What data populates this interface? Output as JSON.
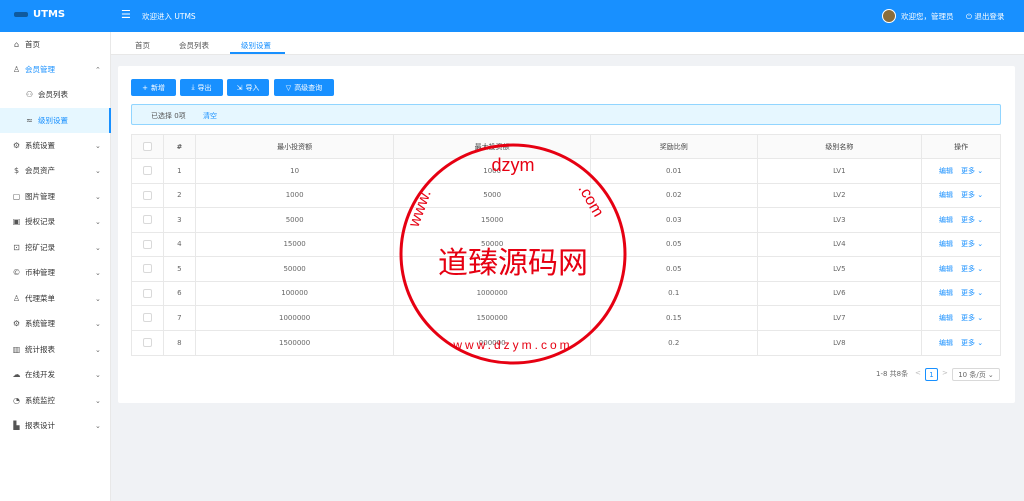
{
  "header": {
    "app_title": "UTMS",
    "fold_icon": "menu-fold-icon",
    "welcome": "欢迎进入 UTMS",
    "greeting": "欢迎您，管理员",
    "logout": "退出登录"
  },
  "sidebar": {
    "items": [
      {
        "icon": "⌂",
        "label": "首页",
        "chevron": ""
      },
      {
        "icon": "♙",
        "label": "会员管理",
        "chevron": "⌃"
      },
      {
        "icon": "⚇",
        "label": "会员列表",
        "chevron": ""
      },
      {
        "icon": "≈",
        "label": "级别设置",
        "chevron": ""
      },
      {
        "icon": "⚙",
        "label": "系统设置",
        "chevron": "⌄"
      },
      {
        "icon": "$",
        "label": "会员资产",
        "chevron": "⌄"
      },
      {
        "icon": "▢",
        "label": "图片管理",
        "chevron": "⌄"
      },
      {
        "icon": "▣",
        "label": "授权记录",
        "chevron": "⌄"
      },
      {
        "icon": "⊡",
        "label": "挖矿记录",
        "chevron": "⌄"
      },
      {
        "icon": "©",
        "label": "币种管理",
        "chevron": "⌄"
      },
      {
        "icon": "♙",
        "label": "代理菜单",
        "chevron": "⌄"
      },
      {
        "icon": "⚙",
        "label": "系统管理",
        "chevron": "⌄"
      },
      {
        "icon": "▥",
        "label": "统计报表",
        "chevron": "⌄"
      },
      {
        "icon": "☁",
        "label": "在线开发",
        "chevron": "⌄"
      },
      {
        "icon": "◔",
        "label": "系统监控",
        "chevron": "⌄"
      },
      {
        "icon": "▙",
        "label": "报表设计",
        "chevron": "⌄"
      }
    ]
  },
  "tabs": [
    "首页",
    "会员列表",
    "级别设置"
  ],
  "toolbar": {
    "add": "新增",
    "export": "导出",
    "import": "导入",
    "query": "高级查询"
  },
  "alert": {
    "selected": "已选择 0项",
    "clear": "清空"
  },
  "table": {
    "headers": [
      "",
      "#",
      "最小投资额",
      "最大投资额",
      "奖励比例",
      "级别名称",
      "操作"
    ],
    "rows": [
      [
        "1",
        "10",
        "1000",
        "0.01",
        "LV1"
      ],
      [
        "2",
        "1000",
        "5000",
        "0.02",
        "LV2"
      ],
      [
        "3",
        "5000",
        "15000",
        "0.03",
        "LV3"
      ],
      [
        "4",
        "15000",
        "50000",
        "0.05",
        "LV4"
      ],
      [
        "5",
        "50000",
        "",
        "0.05",
        "LV5"
      ],
      [
        "6",
        "100000",
        "1000000",
        "0.1",
        "LV6"
      ],
      [
        "7",
        "1000000",
        "1500000",
        "0.15",
        "LV7"
      ],
      [
        "8",
        "1500000",
        "000000",
        "0.2",
        "LV8"
      ]
    ],
    "edit": "编辑",
    "more": "更多 ⌄"
  },
  "pagination": {
    "total": "1-8 共8条",
    "prev": "<",
    "current": "1",
    "next": ">",
    "size": "10 条/页 ⌄"
  },
  "watermark": {
    "top": "dzym",
    "left": "www.",
    "right": ".com",
    "center": "道臻源码网",
    "bottom": "www.dzym.com",
    "color": "#e60012"
  }
}
